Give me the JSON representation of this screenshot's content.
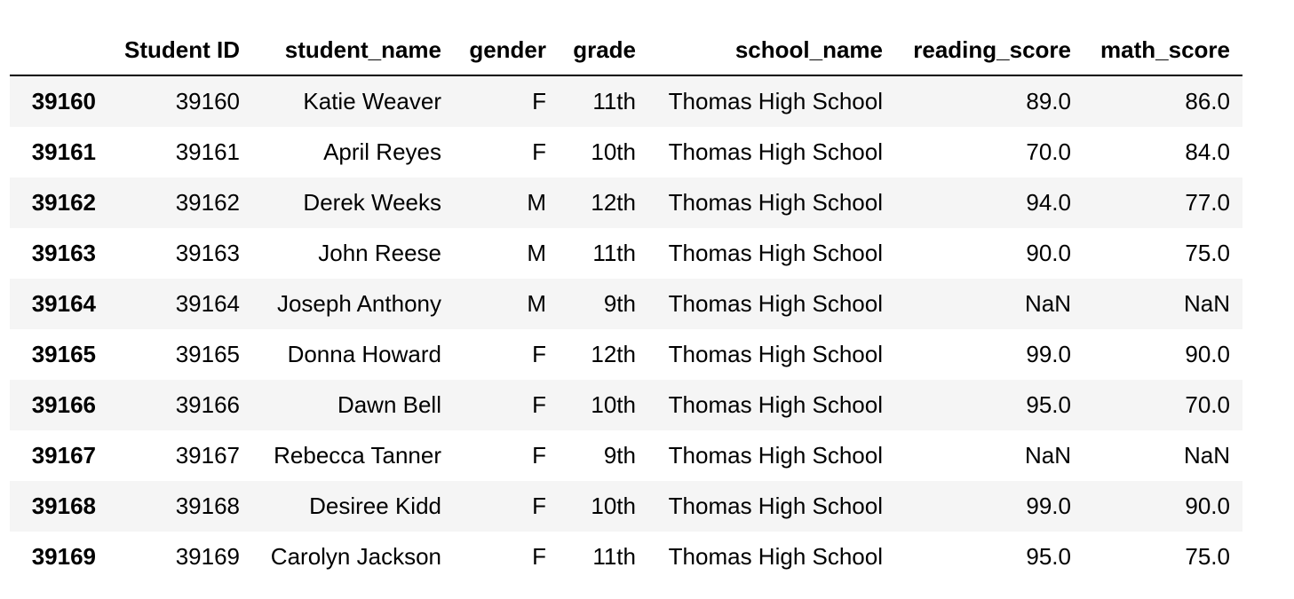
{
  "table": {
    "columns": [
      "",
      "Student ID",
      "student_name",
      "gender",
      "grade",
      "school_name",
      "reading_score",
      "math_score"
    ],
    "rows": [
      {
        "index": "39160",
        "student_id": "39160",
        "student_name": "Katie Weaver",
        "gender": "F",
        "grade": "11th",
        "school_name": "Thomas High School",
        "reading_score": "89.0",
        "math_score": "86.0"
      },
      {
        "index": "39161",
        "student_id": "39161",
        "student_name": "April Reyes",
        "gender": "F",
        "grade": "10th",
        "school_name": "Thomas High School",
        "reading_score": "70.0",
        "math_score": "84.0"
      },
      {
        "index": "39162",
        "student_id": "39162",
        "student_name": "Derek Weeks",
        "gender": "M",
        "grade": "12th",
        "school_name": "Thomas High School",
        "reading_score": "94.0",
        "math_score": "77.0"
      },
      {
        "index": "39163",
        "student_id": "39163",
        "student_name": "John Reese",
        "gender": "M",
        "grade": "11th",
        "school_name": "Thomas High School",
        "reading_score": "90.0",
        "math_score": "75.0"
      },
      {
        "index": "39164",
        "student_id": "39164",
        "student_name": "Joseph Anthony",
        "gender": "M",
        "grade": "9th",
        "school_name": "Thomas High School",
        "reading_score": "NaN",
        "math_score": "NaN"
      },
      {
        "index": "39165",
        "student_id": "39165",
        "student_name": "Donna Howard",
        "gender": "F",
        "grade": "12th",
        "school_name": "Thomas High School",
        "reading_score": "99.0",
        "math_score": "90.0"
      },
      {
        "index": "39166",
        "student_id": "39166",
        "student_name": "Dawn Bell",
        "gender": "F",
        "grade": "10th",
        "school_name": "Thomas High School",
        "reading_score": "95.0",
        "math_score": "70.0"
      },
      {
        "index": "39167",
        "student_id": "39167",
        "student_name": "Rebecca Tanner",
        "gender": "F",
        "grade": "9th",
        "school_name": "Thomas High School",
        "reading_score": "NaN",
        "math_score": "NaN"
      },
      {
        "index": "39168",
        "student_id": "39168",
        "student_name": "Desiree Kidd",
        "gender": "F",
        "grade": "10th",
        "school_name": "Thomas High School",
        "reading_score": "99.0",
        "math_score": "90.0"
      },
      {
        "index": "39169",
        "student_id": "39169",
        "student_name": "Carolyn Jackson",
        "gender": "F",
        "grade": "11th",
        "school_name": "Thomas High School",
        "reading_score": "95.0",
        "math_score": "75.0"
      }
    ]
  }
}
